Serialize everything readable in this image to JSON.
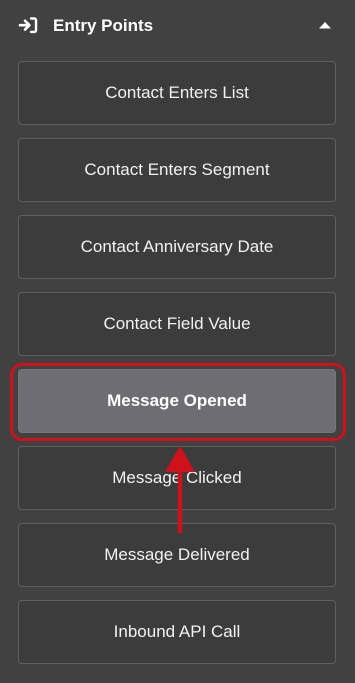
{
  "header": {
    "icon": "sign-in-icon",
    "title": "Entry Points",
    "collapse_icon": "chevron-up-icon"
  },
  "items": [
    {
      "label": "Contact Enters List",
      "selected": false
    },
    {
      "label": "Contact Enters Segment",
      "selected": false
    },
    {
      "label": "Contact Anniversary Date",
      "selected": false
    },
    {
      "label": "Contact Field Value",
      "selected": false
    },
    {
      "label": "Message Opened",
      "selected": true
    },
    {
      "label": "Message Clicked",
      "selected": false
    },
    {
      "label": "Message Delivered",
      "selected": false
    },
    {
      "label": "Inbound API Call",
      "selected": false
    }
  ],
  "colors": {
    "background": "#414141",
    "button_bg": "#3c3c3c",
    "button_border": "#5f5f5f",
    "selected_bg": "#6d6d73",
    "annotation_red": "#d0101a"
  }
}
